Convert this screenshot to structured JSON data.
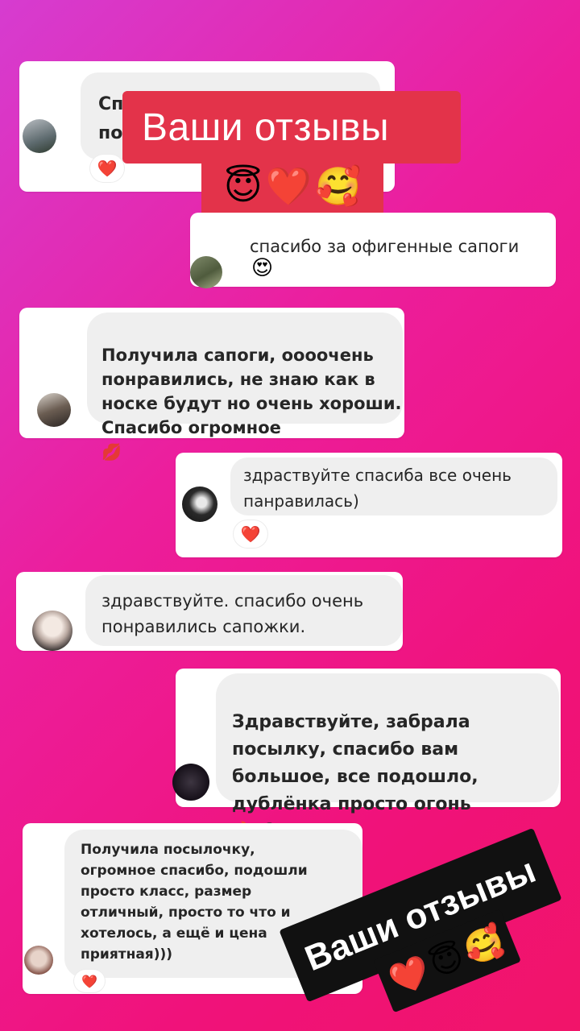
{
  "sticker_top": {
    "title": "Ваши отзывы",
    "emojis": [
      "😇",
      "❤️",
      "🥰"
    ]
  },
  "sticker_bottom": {
    "title": "Ваши отзывы",
    "emojis": [
      "❤️",
      "😇",
      "🥰"
    ]
  },
  "reviews": [
    {
      "text": "Сп\nпо",
      "reaction": "❤️",
      "has_reaction": true
    },
    {
      "text": "спасибо за офигенные сапоги",
      "emoji": "😍"
    },
    {
      "text": "Получила сапоги, оооочень\nпонравились, не знаю как в\nноске будут но очень хороши.\nСпасибо огромное",
      "emoji": "💋"
    },
    {
      "text": "здраствуйте спасиба все очень\nпанравилась)",
      "reaction": "❤️",
      "has_reaction": true
    },
    {
      "text": "здравствуйте. спасибо очень\nпонравились сапожки."
    },
    {
      "text": "Здравствуйте, забрала\nпосылку, спасибо вам\nбольшое, все подошло,\nдублёнка просто огонь",
      "emoji": "🔥 😍"
    },
    {
      "text": "Получила посылочку,\nогромное  спасибо,  подошли\nпросто класс, размер\nотличный, просто  то что и\nхотелось, а ещё и цена\nприятная)))",
      "reaction": "❤️",
      "has_reaction": true
    }
  ],
  "icons": {
    "avatar": "avatar-photo",
    "reaction": "heart-icon"
  },
  "colors": {
    "sticker_red": "#e3334a",
    "sticker_black": "#111111",
    "bubble": "#efefef"
  }
}
